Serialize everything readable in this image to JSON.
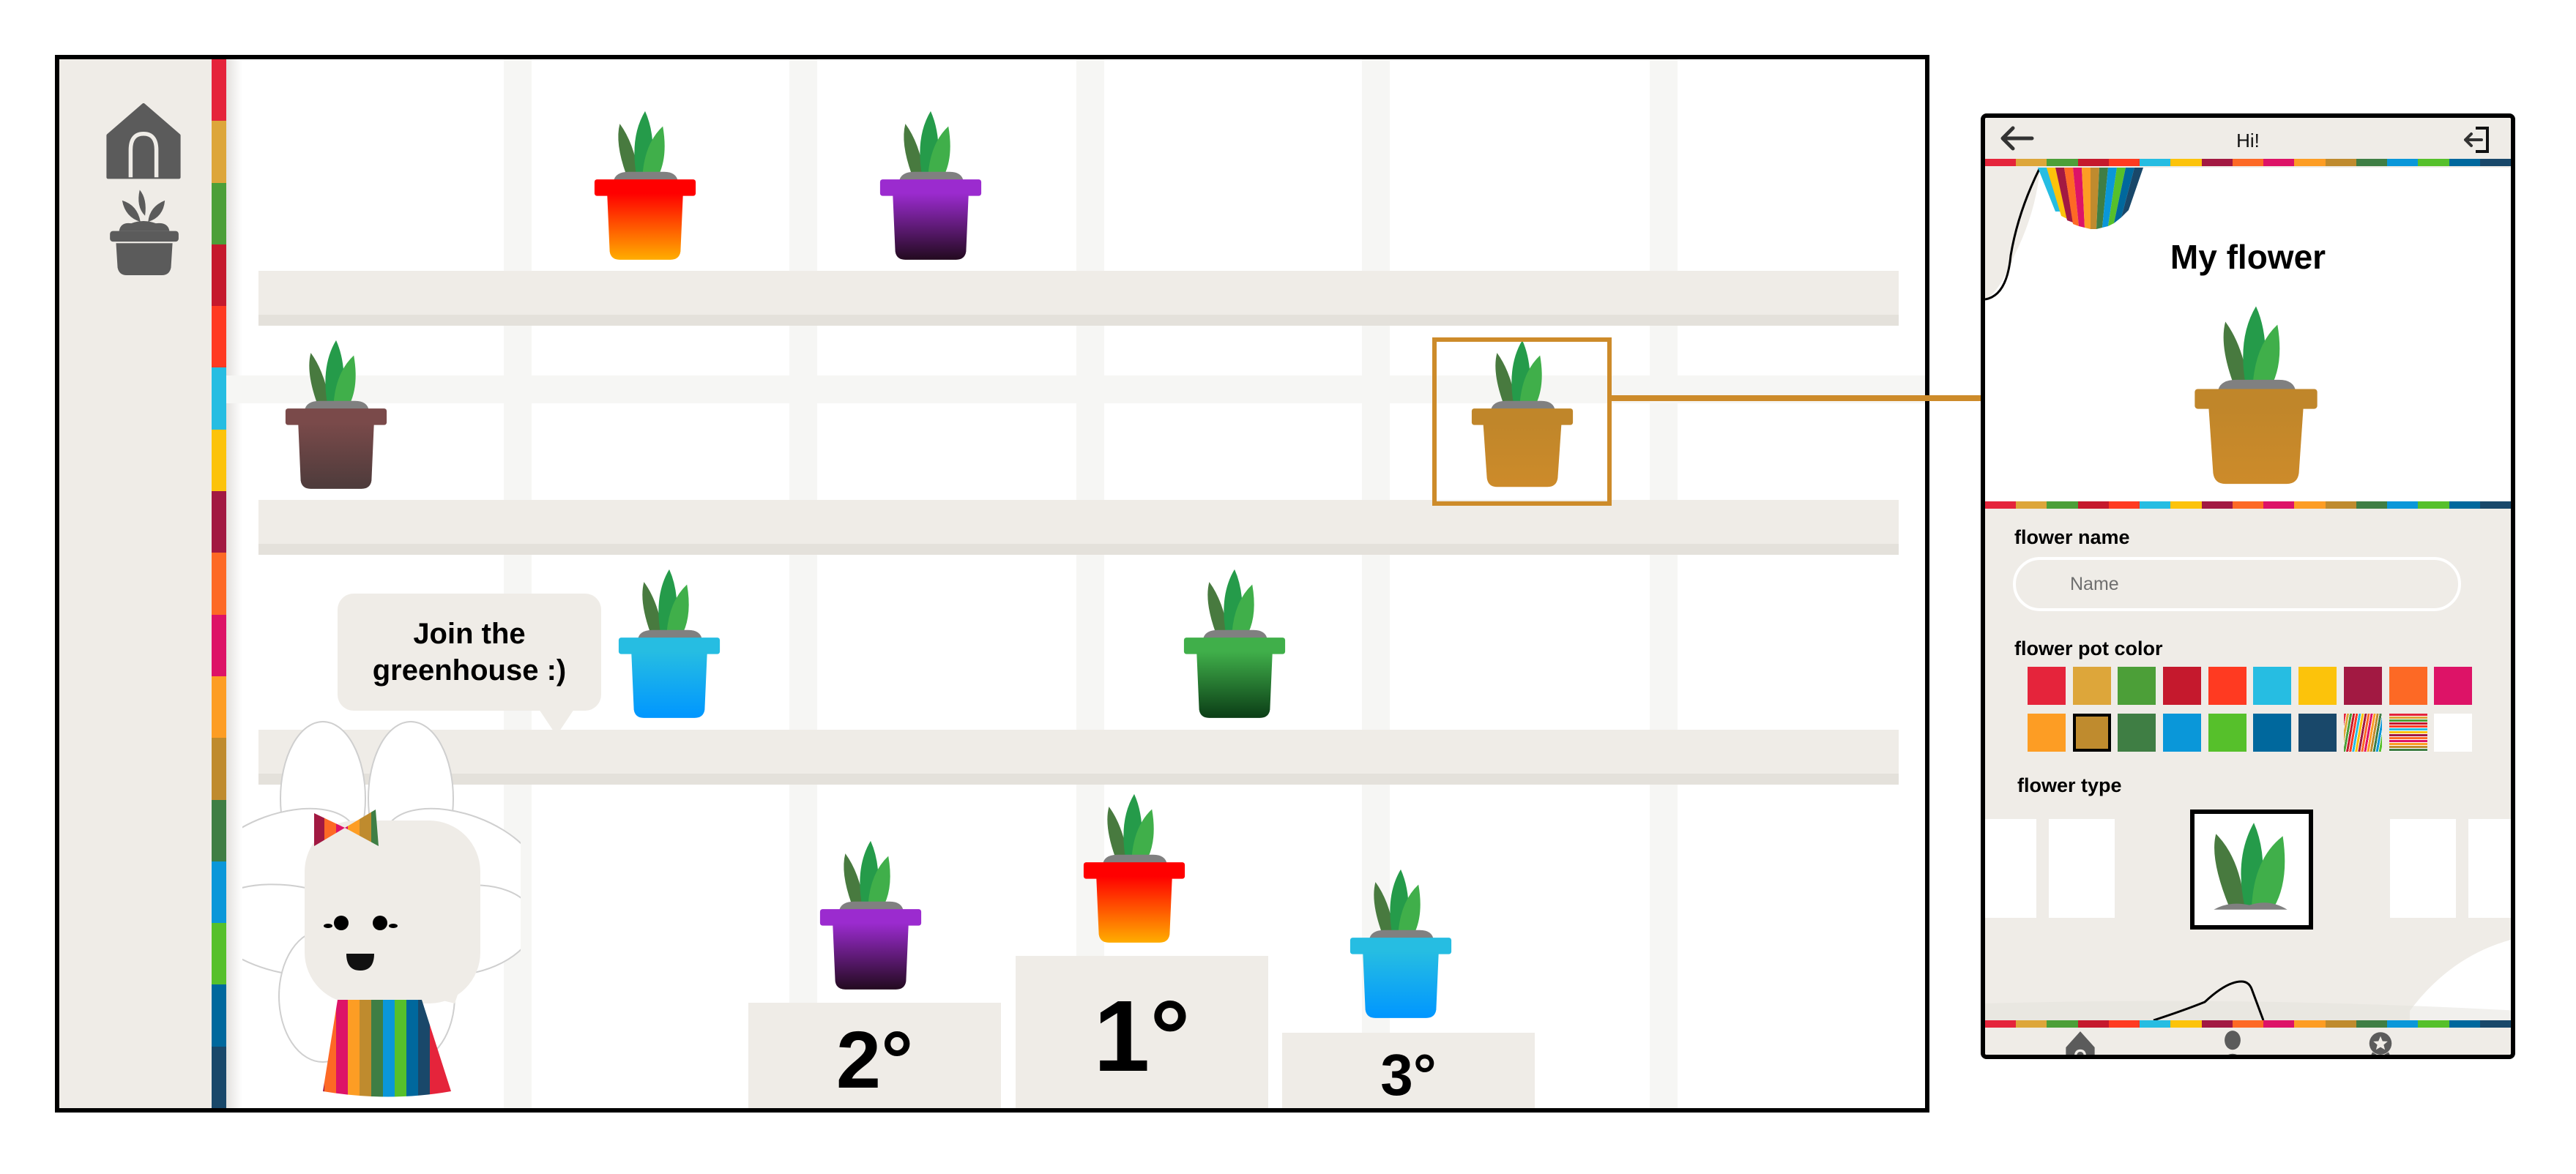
{
  "palette": {
    "sdg": [
      "#e5243b",
      "#dda63a",
      "#4c9f38",
      "#c5192d",
      "#ff3a21",
      "#26bde2",
      "#fcc30b",
      "#a21942",
      "#fd6925",
      "#dd1367",
      "#fd9d24",
      "#bf8b2e",
      "#3f7e44",
      "#0a97d9",
      "#56c02b",
      "#00689d",
      "#19486a"
    ],
    "accent": "#cd8b2a",
    "panel": "#efece7",
    "icon": "#5b5b5b"
  },
  "main": {
    "sidebar": {
      "items": [
        {
          "name": "home",
          "icon": "house-icon"
        },
        {
          "name": "my-plants",
          "icon": "potted-plant-icon"
        }
      ]
    },
    "shelves": [
      {
        "row": 1,
        "pots": [
          {
            "color_top": "#ff0000",
            "color_bottom": "#ffad00"
          },
          {
            "color_top": "#9b2bcf",
            "color_bottom": "#230a1f"
          }
        ]
      },
      {
        "row": 2,
        "pots": [
          {
            "color_top": "#7a4a4a",
            "color_bottom": "#4d3b3b"
          },
          {
            "color_top": "#c0862a",
            "color_bottom": "#cd8b2a",
            "selected": true
          }
        ]
      },
      {
        "row": 3,
        "pots": [
          {
            "color_top": "#26bde2",
            "color_bottom": "#0096ff"
          },
          {
            "color_top": "#40af4a",
            "color_bottom": "#0b3d16"
          }
        ]
      }
    ],
    "bubble": {
      "line1": "Join the",
      "line2": "greenhouse :)"
    },
    "podium": [
      {
        "rank": "1°",
        "color_top": "#ff0000",
        "color_bottom": "#ffad00"
      },
      {
        "rank": "2°",
        "color_top": "#9b2bcf",
        "color_bottom": "#230a1f"
      },
      {
        "rank": "3°",
        "color_top": "#26bde2",
        "color_bottom": "#0096ff"
      }
    ]
  },
  "phone": {
    "header": {
      "title": "Hi!",
      "back_icon": "arrow-left-icon",
      "logout_icon": "logout-icon"
    },
    "hero_title": "My flower",
    "flower_name": {
      "label": "flower name",
      "placeholder": "Name",
      "value": ""
    },
    "pot_color": {
      "label": "flower pot color",
      "options": [
        "#e5243b",
        "#dda63a",
        "#4c9f38",
        "#c5192d",
        "#ff3a21",
        "#26bde2",
        "#fcc30b",
        "#a21942",
        "#fd6925",
        "#dd1367",
        "#fd9d24",
        "#bf8b2e",
        "#3f7e44",
        "#0a97d9",
        "#56c02b",
        "#00689d",
        "#19486a",
        "diagonal-stripes",
        "horizontal-stripes",
        "#ffffff"
      ],
      "selected_index": 11
    },
    "flower_type": {
      "label": "flower type",
      "selected": "green-leaves"
    },
    "nav": [
      {
        "name": "home",
        "icon": "house-icon"
      },
      {
        "name": "profile",
        "icon": "person-icon"
      },
      {
        "name": "awards",
        "icon": "award-icon"
      }
    ]
  }
}
